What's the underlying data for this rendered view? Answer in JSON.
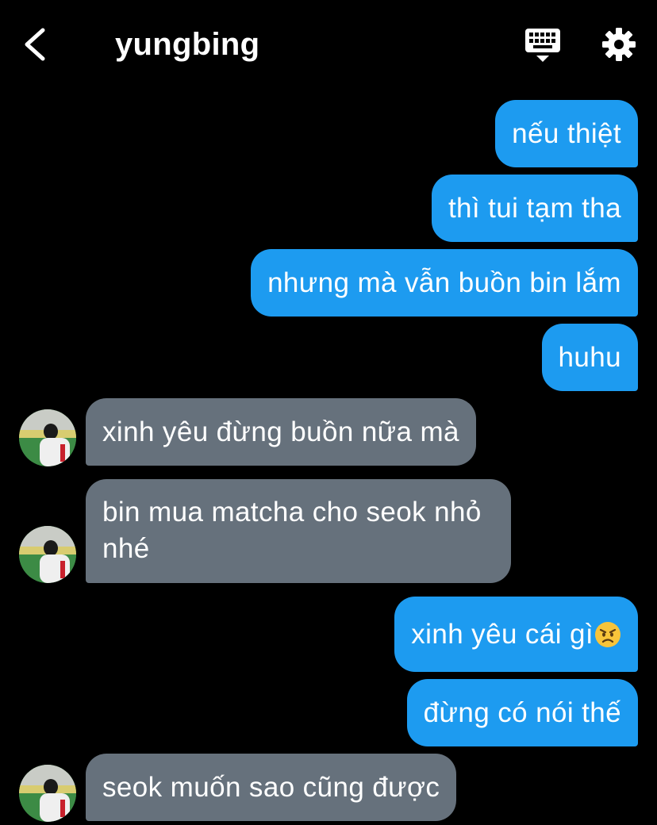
{
  "header": {
    "back_icon": "chevron-left-icon",
    "title": "yungbing",
    "keyboard_icon": "keyboard-icon",
    "settings_icon": "gear-icon"
  },
  "colors": {
    "background": "#000000",
    "outgoing_bubble": "#1d9bf0",
    "incoming_bubble": "#66717c",
    "text": "#ffffff"
  },
  "messages": [
    {
      "sender": "me",
      "text": "nếu thiệt"
    },
    {
      "sender": "me",
      "text": "thì tui tạm tha"
    },
    {
      "sender": "me",
      "text": "nhưng mà vẫn buồn bin lắm"
    },
    {
      "sender": "me",
      "text": "huhu"
    },
    {
      "sender": "them",
      "text": "xinh yêu đừng buồn nữa mà"
    },
    {
      "sender": "them",
      "text": "bin mua matcha cho seok nhỏ nhé"
    },
    {
      "sender": "me",
      "text": "xinh yêu cái gì",
      "emoji": "angry-face-emoji"
    },
    {
      "sender": "me",
      "text": "đừng có nói thế"
    },
    {
      "sender": "them",
      "text": "seok muốn sao cũng được"
    }
  ]
}
